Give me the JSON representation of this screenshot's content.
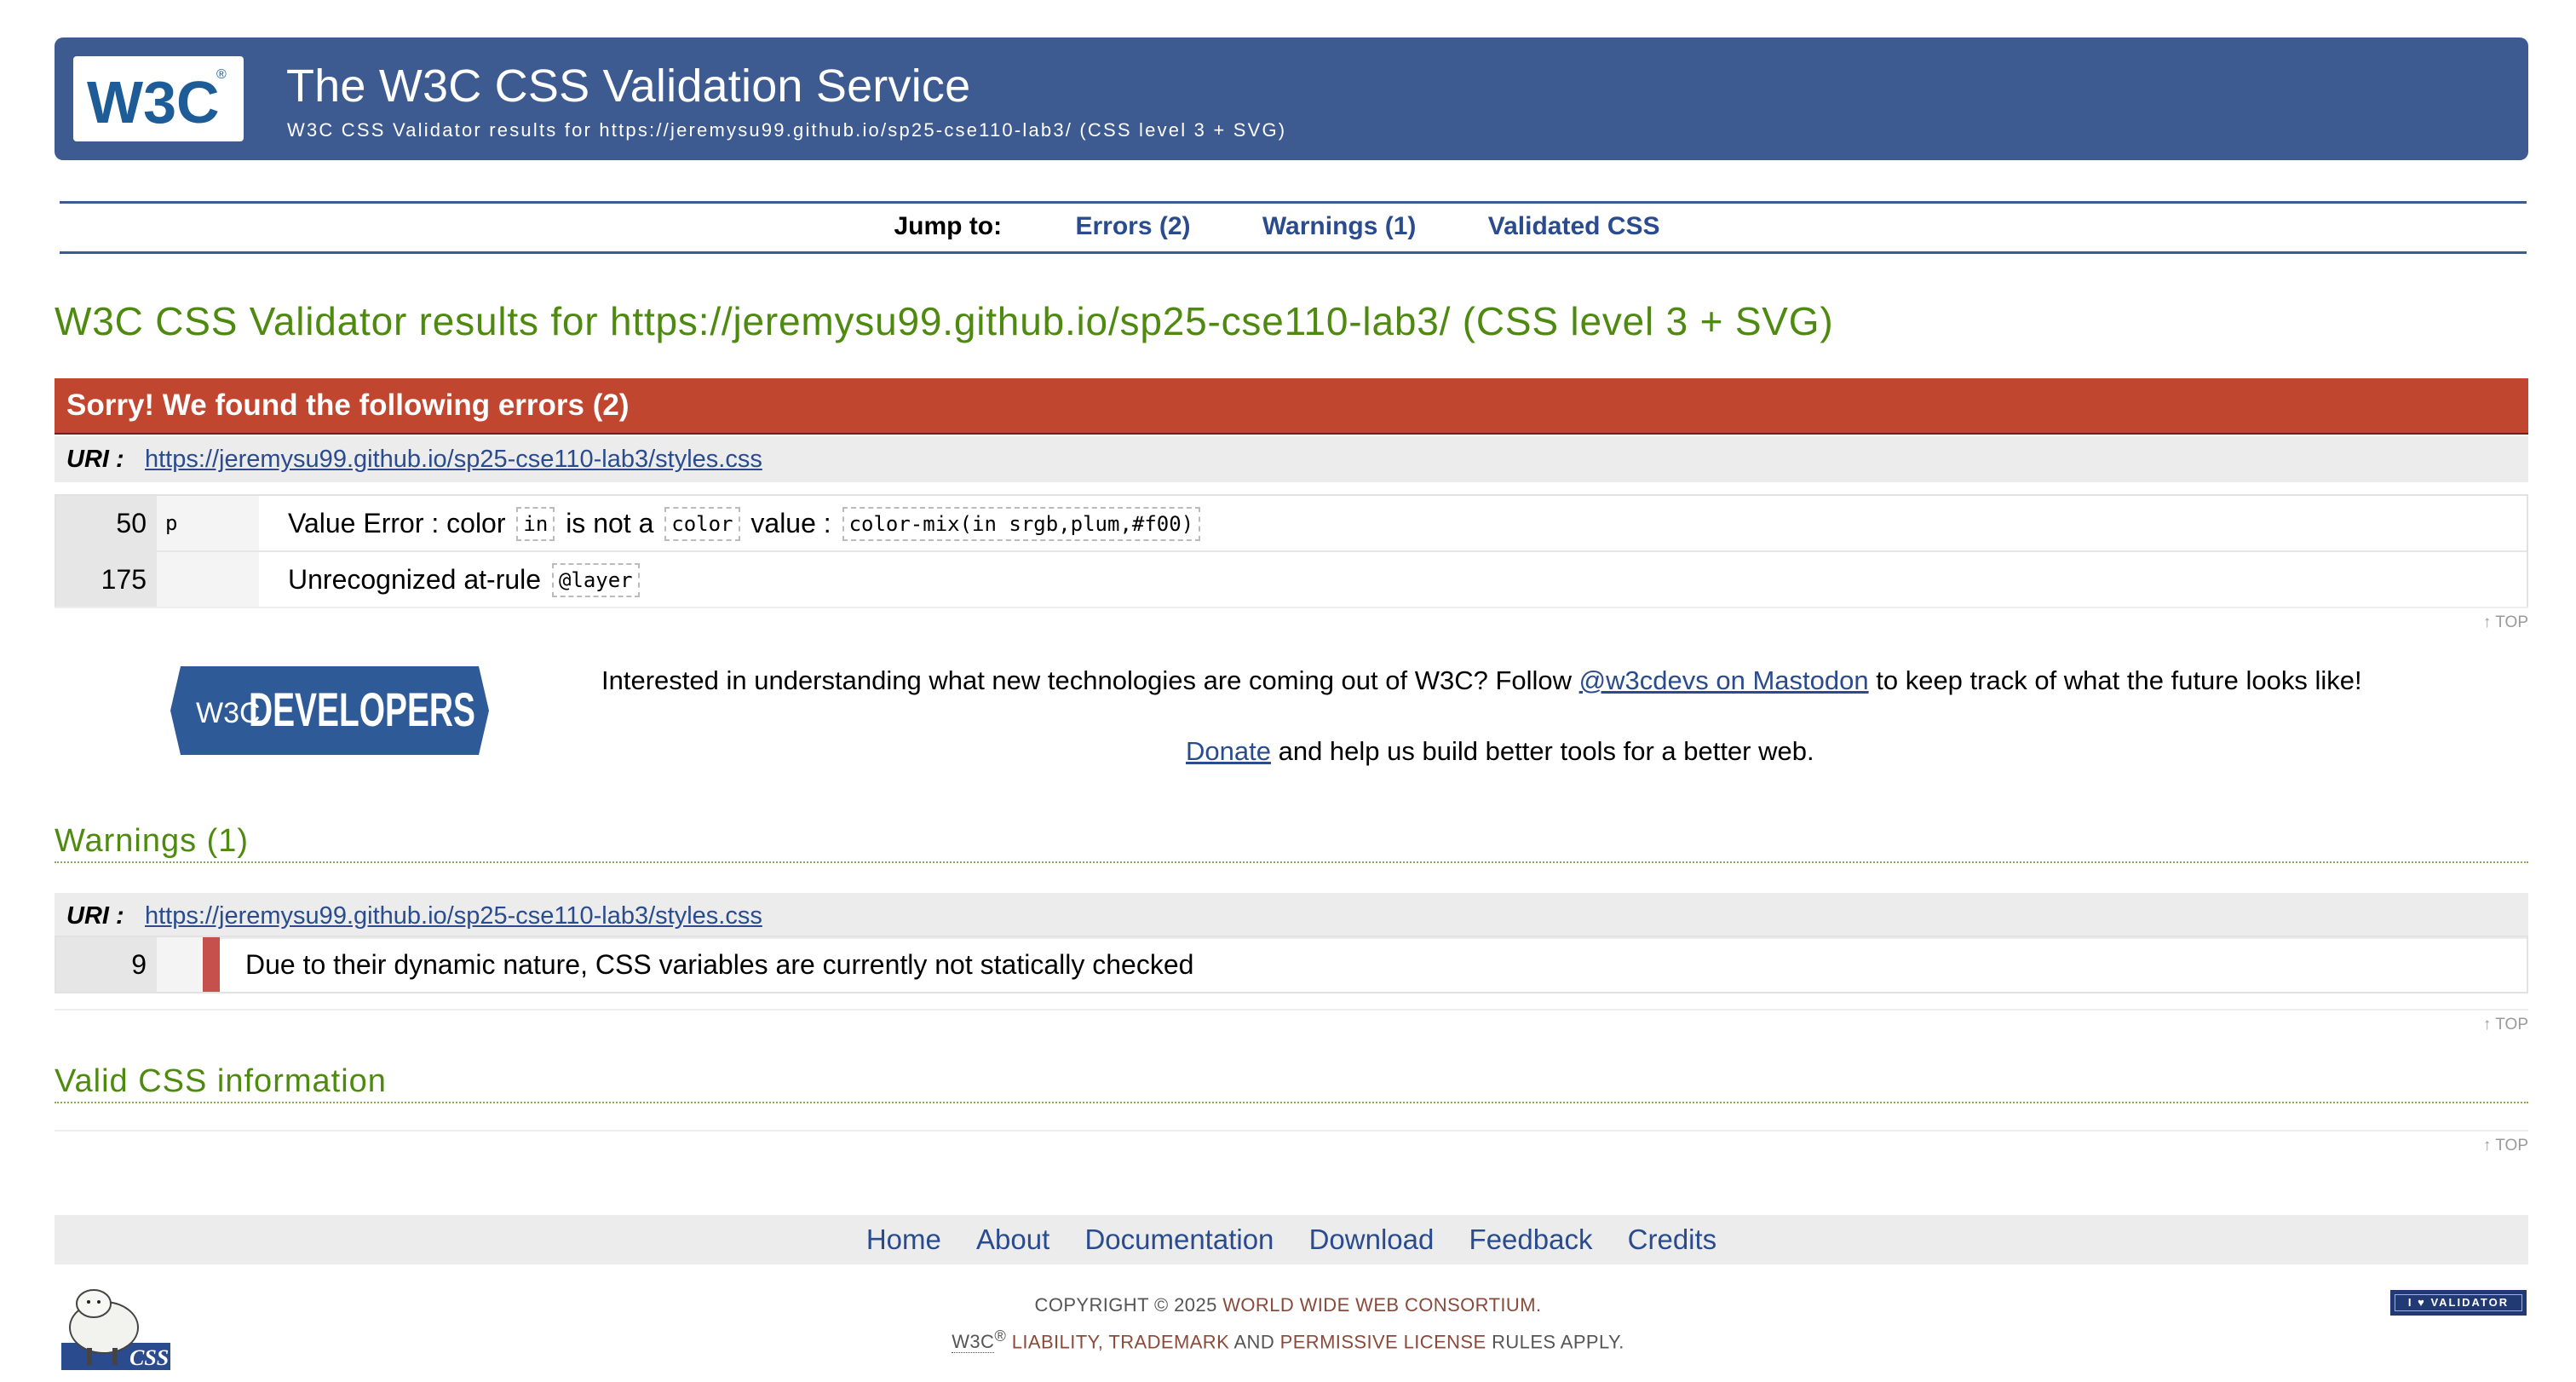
{
  "banner": {
    "logo_text": "W3C",
    "title": "The W3C CSS Validation Service",
    "subtitle": "W3C CSS Validator results for https://jeremysu99.github.io/sp25-cse110-lab3/ (CSS level 3 + SVG)"
  },
  "jump": {
    "label": "Jump to:",
    "errors": "Errors (2)",
    "warnings": "Warnings (1)",
    "valid": "Validated CSS"
  },
  "results_title": "W3C CSS Validator results for https://jeremysu99.github.io/sp25-cse110-lab3/ (CSS level 3 + SVG)",
  "errors": {
    "heading": "Sorry! We found the following errors (2)",
    "uri_label": "URI :",
    "uri": "https://jeremysu99.github.io/sp25-cse110-lab3/styles.css",
    "rows": [
      {
        "line": "50",
        "context": "p",
        "msg_a": "Value Error : color",
        "code_a": "in",
        "msg_b": "is not a",
        "code_b": "color",
        "msg_c": "value :",
        "code_c": "color-mix(in srgb,plum,#f00)"
      },
      {
        "line": "175",
        "context": "",
        "msg_a": "Unrecognized at-rule",
        "code_a": "@layer"
      }
    ]
  },
  "top_label": "↑ TOP",
  "promo": {
    "badge_left": "W3C",
    "badge_right": "DEVELOPERS",
    "text_before": "Interested in understanding what new technologies are coming out of W3C? Follow",
    "link": "@w3cdevs on Mastodon",
    "text_after": "to keep track of what the future looks like!",
    "donate_link": "Donate",
    "donate_after": "and help us build better tools for a better web."
  },
  "warnings": {
    "heading": "Warnings (1)",
    "uri_label": "URI :",
    "uri": "https://jeremysu99.github.io/sp25-cse110-lab3/styles.css",
    "rows": [
      {
        "line": "9",
        "msg": "Due to their dynamic nature, CSS variables are currently not statically checked"
      }
    ]
  },
  "valid": {
    "heading": "Valid CSS information"
  },
  "footer": {
    "nav": [
      "Home",
      "About",
      "Documentation",
      "Download",
      "Feedback",
      "Credits"
    ],
    "copyright_prefix": "COPYRIGHT © 2025",
    "copyright_org": "WORLD WIDE WEB CONSORTIUM.",
    "w3c": "W3C",
    "reg": "®",
    "liability": "LIABILITY,",
    "trademark": "TRADEMARK",
    "and": "AND",
    "license": "PERMISSIVE LICENSE",
    "rules": "RULES APPLY.",
    "sheep_label": "CSS",
    "badge": "I ♥ VALIDATOR"
  },
  "colors": {
    "banner": "#3d5b91",
    "error_header": "#c0462f",
    "green_heading": "#4f8a10",
    "link": "#2a4b8d",
    "warning_bar": "#c6504c"
  }
}
